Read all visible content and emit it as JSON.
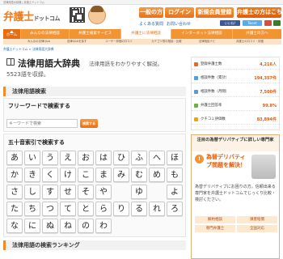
{
  "topbar": {
    "text": "法律用語大辞典 | 弁護士ドットコム"
  },
  "header": {
    "logo_main": "弁護士",
    "logo_sub": "ドットコム",
    "btn_general": "一般の方",
    "btn_login": "ログイン",
    "btn_register": "新規会員登録",
    "btn_lawyers": "弁護士の方はこちら",
    "link_faq": "よくある質問",
    "link_help": "お問い合わせ",
    "fb_label": "いいね!",
    "tw_label": "Tweet"
  },
  "nav": {
    "home": "ホーム",
    "items": [
      "みんなの法律相談",
      "弁護士検索サービス",
      "弁護士に法律相談",
      "インターネット法律相談",
      "弁護士の方へ"
    ]
  },
  "subnav": {
    "items": [
      "みんなの法律Q&A",
      "法律Q&Aを探す",
      "ユーザー評価の口コミ",
      "カテゴリ別の相談・比較",
      "法律相談ナビ",
      "弁護士の口コミ・評価"
    ]
  },
  "breadcrumb": "弁護士ドットコム > 法律用語大辞典",
  "main": {
    "title": "法律用語大辞典",
    "tagline": "法律用語をわかりやすく解説。",
    "count_text": "5523語を収録。",
    "search_section": "法律用語検索",
    "freeword_heading": "フリーワードで検索する",
    "search_placeholder": "キーワードで検索",
    "search_button": "検索する",
    "gojuon_heading": "五十音索引で検索する",
    "kana_rows": [
      [
        "あ",
        "い",
        "う",
        "え",
        "お",
        "は",
        "ひ",
        "ふ",
        "へ",
        "ほ"
      ],
      [
        "か",
        "き",
        "く",
        "け",
        "こ",
        "ま",
        "み",
        "む",
        "め",
        "も"
      ],
      [
        "さ",
        "し",
        "す",
        "せ",
        "そ",
        "や",
        "",
        "ゆ",
        "",
        "よ"
      ],
      [
        "た",
        "ち",
        "つ",
        "て",
        "と",
        "ら",
        "り",
        "る",
        "れ",
        "ろ"
      ],
      [
        "な",
        "に",
        "ぬ",
        "ね",
        "の",
        "わ",
        "",
        "",
        "",
        ""
      ]
    ],
    "ranking_heading": "法律用語の検索ランキング"
  },
  "stats": {
    "rows": [
      {
        "label": "登録弁護士数",
        "value": "4,216人",
        "color": "#e46a2a"
      },
      {
        "label": "相談件数（累計）",
        "value": "194,357件",
        "color": "#5a9bd6"
      },
      {
        "label": "相談件数（月間）",
        "value": "7,500件",
        "color": "#5a9bd6"
      },
      {
        "label": "弁護士回答率",
        "value": "99.8%",
        "color": "#6bb14a"
      },
      {
        "label": "クチコミ評価数",
        "value": "83,894件",
        "color": "#e8a51a"
      }
    ]
  },
  "side": {
    "notice_head": "注目の為替デリバティブに詳しい専門家",
    "banner_title": "為替デリバティブ問題を解決！",
    "banner_body": "為替デリバティブにお困りの方。信頼出来る専門家を弁護士ドットコムでじっくり比較・検討ください。",
    "tags": [
      "解約相談",
      "損害賠償",
      "専門弁護士",
      "全国対応"
    ]
  }
}
